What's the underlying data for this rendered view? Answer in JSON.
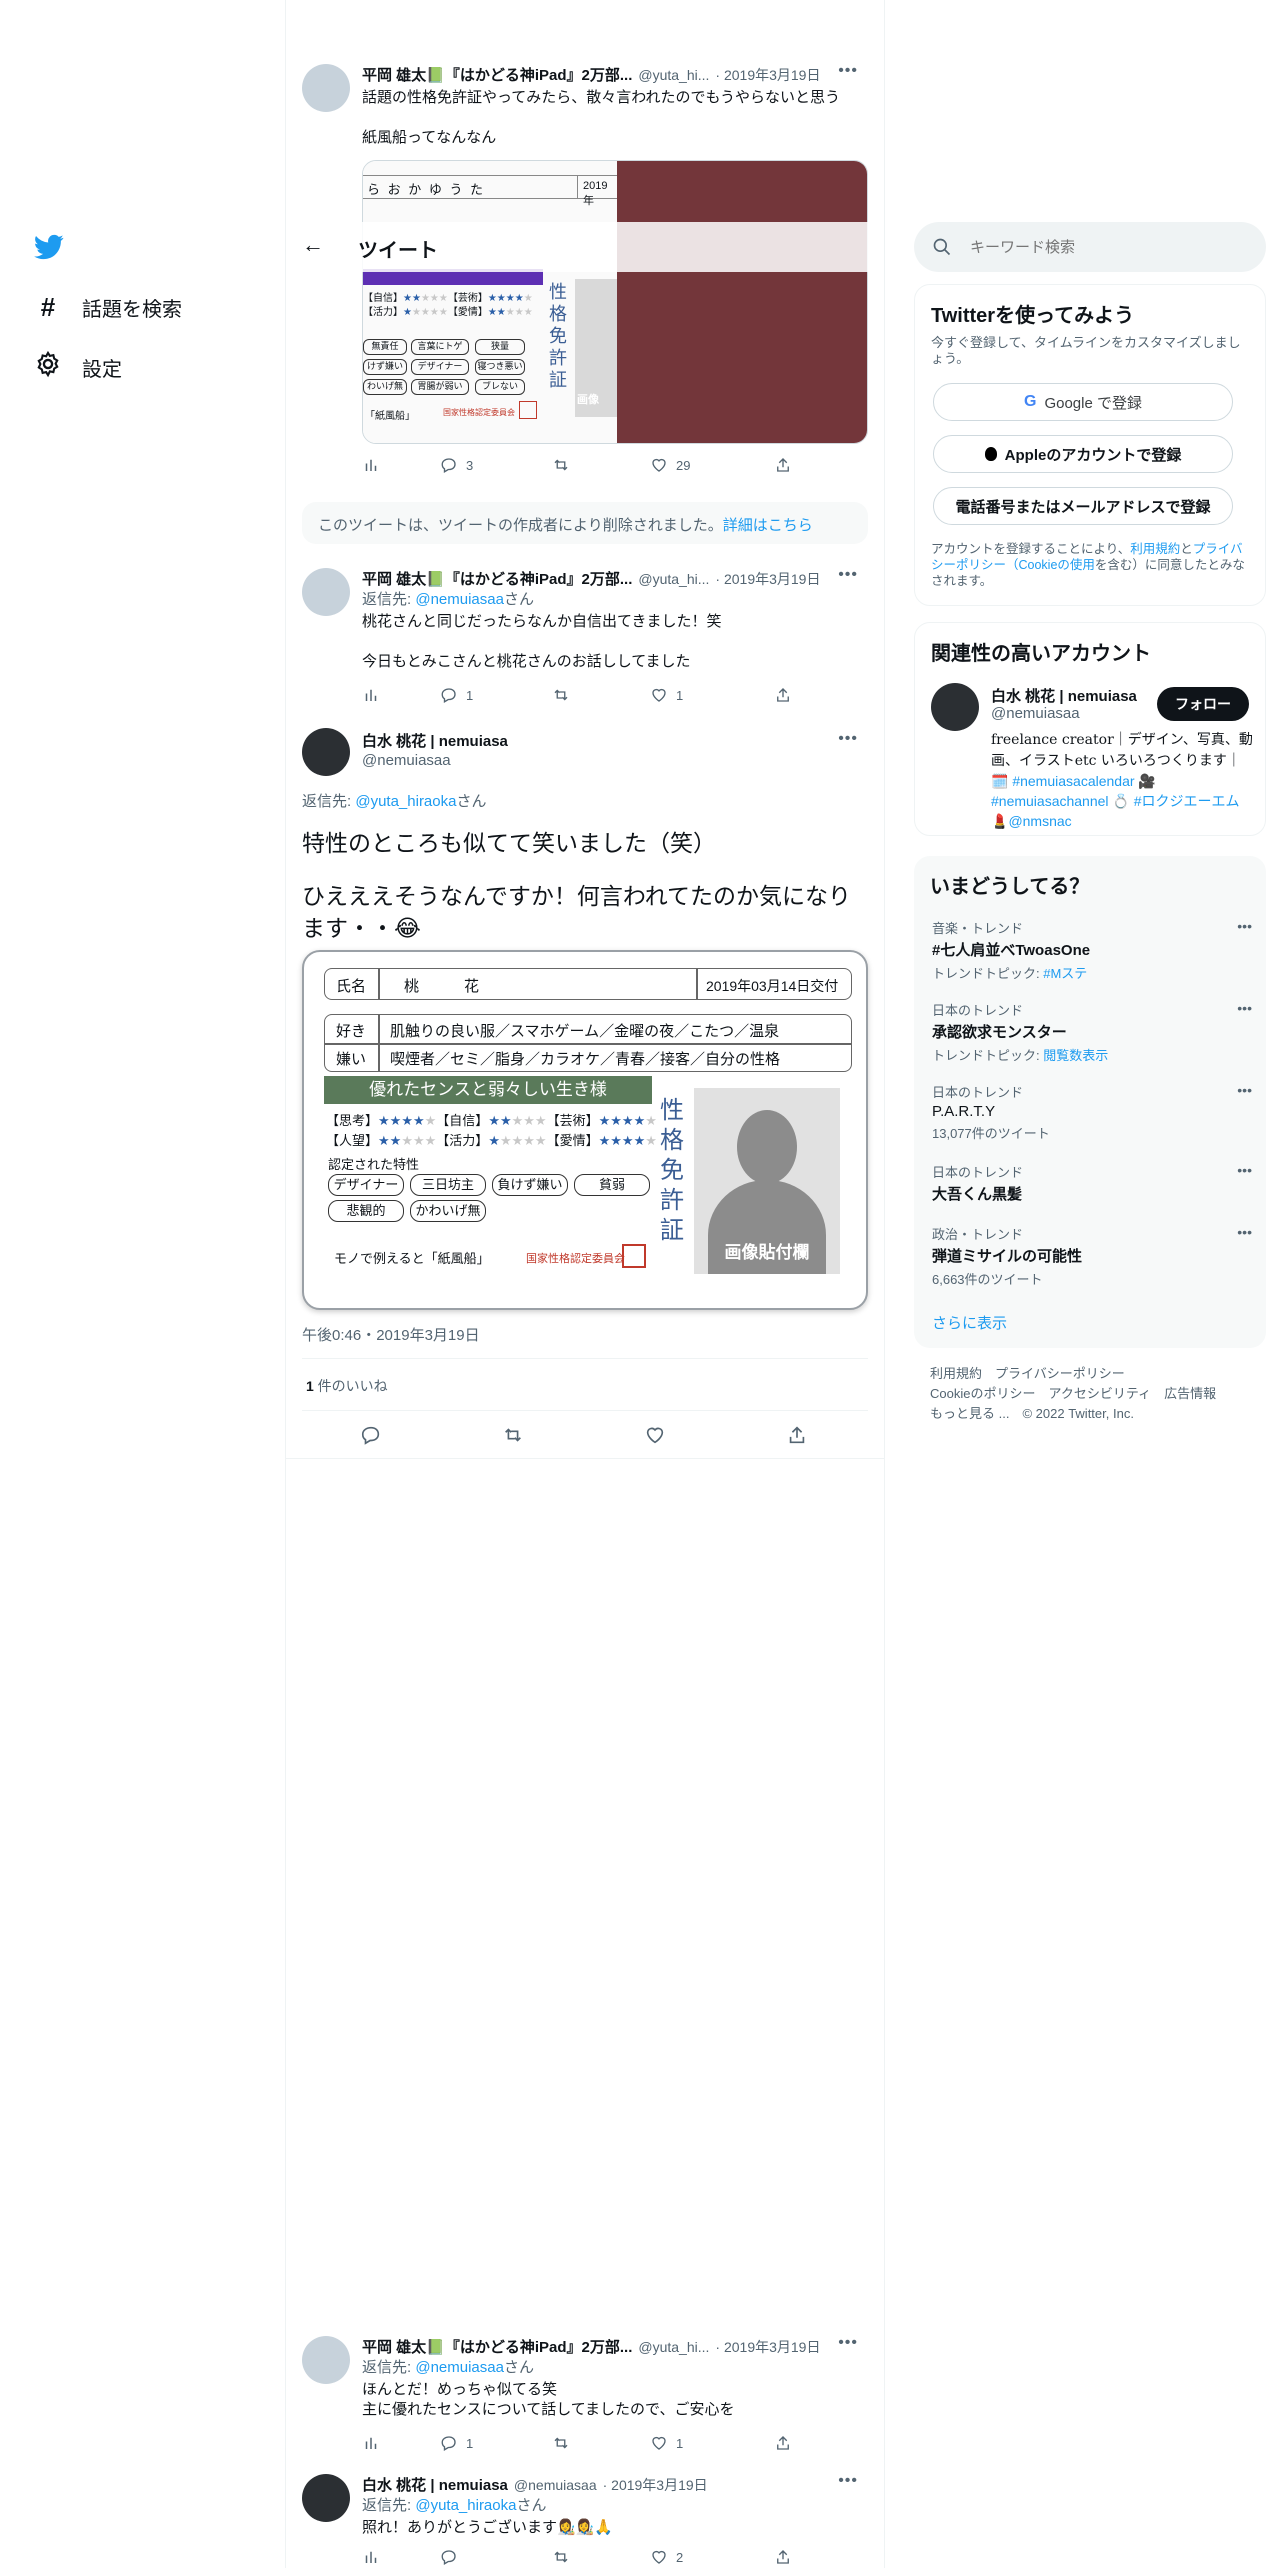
{
  "nav": {
    "explore_label": "話題を検索",
    "settings_label": "設定"
  },
  "header": {
    "title": "ツイート"
  },
  "tweets": {
    "t1": {
      "name": "平岡 雄太📗『はかどる神iPad』2万部...",
      "handle": "@yuta_hi...",
      "date": "· 2019年3月19日",
      "line1": "話題の性格免許証やってみたら、散々言われたのでもうやらないと思う",
      "line2": "紙風船ってなんなん",
      "replies": "3",
      "likes": "29",
      "card_reading": "ら お か ゆ う た",
      "card_date": "2019年",
      "card_star1": "【自信】",
      "card_star2": "【芸術】",
      "card_star3": "【活力】",
      "card_star4": "【愛情】",
      "card_vertical": "性格免許証",
      "card_traits": [
        "無責任",
        "言葉にトゲ",
        "狭量",
        "けず嫌い",
        "デザイナー",
        "寝つき悪い",
        "わいげ無",
        "胃腸が弱い",
        "ブレない"
      ],
      "card_footer": "「紙風船」",
      "card_seal": "国家性格認定委員会",
      "card_photo": "画像"
    },
    "deleted_notice": "このツイートは、ツイートの作成者により削除されました。",
    "deleted_link": "詳細はこちら",
    "t2": {
      "name": "平岡 雄太📗『はかどる神iPad』2万部...",
      "handle": "@yuta_hi...",
      "date": "· 2019年3月19日",
      "reply_prefix": "返信先: ",
      "reply_to": "@nemuiasaa",
      "reply_suffix": "さん",
      "line1": "桃花さんと同じだったらなんか自信出てきました！笑",
      "line2": "今日もとみこさんと桃花さんのお話ししてました",
      "replies": "1",
      "likes": "1"
    },
    "main": {
      "name": "白水 桃花 | nemuiasa",
      "handle": "@nemuiasaa",
      "reply_prefix": "返信先: ",
      "reply_to": "@yuta_hiraoka",
      "reply_suffix": "さん",
      "line1": "特性のところも似てて笑いました（笑）",
      "line2": "ひえええそうなんですか！何言われてたのか気になります・・😂",
      "timestamp": "午後0:46・2019年3月19日",
      "likes_count": "1",
      "likes_label": " 件のいいね"
    },
    "t3": {
      "name": "平岡 雄太📗『はかどる神iPad』2万部...",
      "handle": "@yuta_hi...",
      "date": "· 2019年3月19日",
      "reply_prefix": "返信先: ",
      "reply_to": "@nemuiasaa",
      "reply_suffix": "さん",
      "line1": "ほんとだ！めっちゃ似てる笑",
      "line2": "主に優れたセンスについて話してましたので、ご安心を",
      "replies": "1",
      "likes": "1"
    },
    "t4": {
      "name": "白水 桃花 | nemuiasa",
      "handle": "@nemuiasaa",
      "date": "· 2019年3月19日",
      "reply_prefix": "返信先: ",
      "reply_to": "@yuta_hiraoka",
      "reply_suffix": "さん",
      "line1": "照れ！ありがとうございます👩‍🎨👩‍🎨🙏",
      "likes": "2"
    }
  },
  "license": {
    "name_label": "氏名",
    "name_value": "桃　　　花",
    "issued": "2019年03月14日交付",
    "like_label": "好き",
    "like_value": "肌触りの良い服／スマホゲーム／金曜の夜／こたつ／温泉",
    "dislike_label": "嫌い",
    "dislike_value": "喫煙者／セミ／脂身／カラオケ／青春／接客／自分の性格",
    "banner": "優れたセンスと弱々しい生き様",
    "stat1": "【思考】",
    "stat2": "【自信】",
    "stat3": "【芸術】",
    "stat4": "【人望】",
    "stat5": "【活力】",
    "stat6": "【愛情】",
    "traits_label": "認定された特性",
    "traits": [
      "デザイナー",
      "三日坊主",
      "負けず嫌い",
      "貧弱",
      "悲観的",
      "かわいげ無"
    ],
    "vertical": "性格免許証",
    "photo": "画像貼付欄",
    "footer": "モノで例えると「紙風船」",
    "seal_text": "国家性格認定委員会"
  },
  "right": {
    "search_placeholder": "キーワード検索",
    "signup": {
      "title": "Twitterを使ってみよう",
      "desc": "今すぐ登録して、タイムラインをカスタマイズしましょう。",
      "google": "Google で登録",
      "apple": "Appleのアカウントで登録",
      "phone": "電話番号またはメールアドレスで登録",
      "terms_pre": "アカウントを登録することにより、",
      "terms_link": "利用規約",
      "terms_and": "と",
      "privacy_link": "プライバシーポリシー（Cookieの使用",
      "terms_post": "を含む）に同意したとみなされます。"
    },
    "related": {
      "title": "関連性の高いアカウント",
      "name": "白水 桃花 | nemuiasa",
      "handle": "@nemuiasaa",
      "follow": "フォロー",
      "bio1": "freelance creator｜デザイン、写真、動画、イラストetc いろいろつくりま",
      "bio2": "す｜🗓️",
      "tag1": "#nemuiasacalendar",
      "bio3": " 🎥 ",
      "tag2": "#nemuiasachannel",
      "bio4": " 💍 ",
      "tag3": "#ロクジエーエム",
      "bio5": " 💄",
      "tag4": "@nmsnac"
    },
    "trends": {
      "title": "いまどうしてる？",
      "items": [
        {
          "cat": "音楽・トレンド",
          "title": "#七人肩並べTwoasOne",
          "sub_pre": "トレンドトピック: ",
          "sub_link": "#Mステ"
        },
        {
          "cat": "日本のトレンド",
          "title": "承認欲求モンスター",
          "sub_pre": "トレンドトピック: ",
          "sub_link": "閲覧数表示"
        },
        {
          "cat": "日本のトレンド",
          "title": "P.A.R.T.Y",
          "sub_pre": "13,077件のツイート",
          "sub_link": ""
        },
        {
          "cat": "日本のトレンド",
          "title": "大吾くん黒髪",
          "sub_pre": "",
          "sub_link": ""
        },
        {
          "cat": "政治・トレンド",
          "title": "弾道ミサイルの可能性",
          "sub_pre": "6,663件のツイート",
          "sub_link": ""
        }
      ],
      "more": "さらに表示"
    },
    "footer": {
      "l1": "利用規約",
      "l2": "プライバシーポリシー",
      "l3": "Cookieのポリシー",
      "l4": "アクセシビリティ",
      "l5": "広告情報",
      "l6": "もっと見る ...",
      "copy": "© 2022 Twitter, Inc."
    }
  }
}
